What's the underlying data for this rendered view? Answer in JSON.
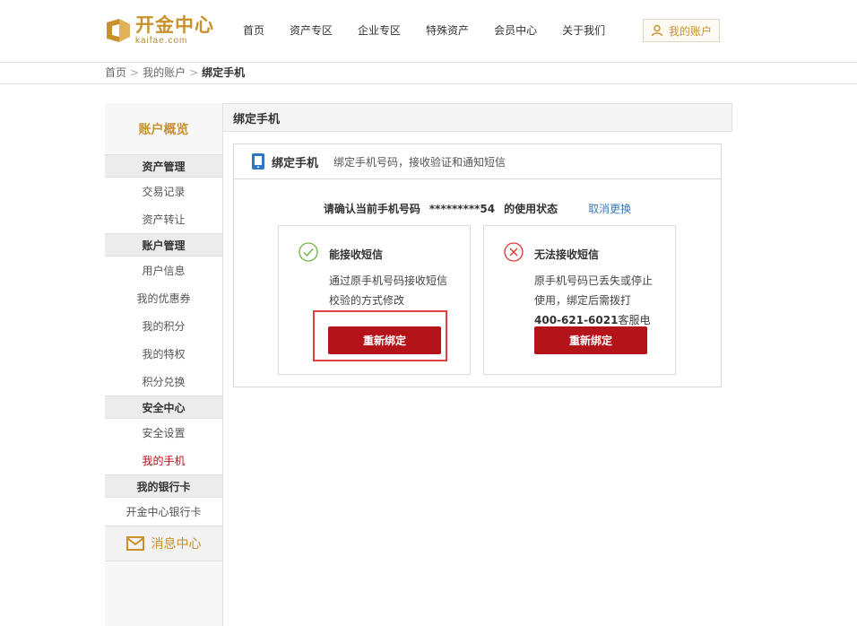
{
  "brand": {
    "name_cn": "开金中心",
    "name_en": "kaifae.com",
    "color": "#c8912c"
  },
  "nav": {
    "items": [
      "首页",
      "资产专区",
      "企业专区",
      "特殊资产",
      "会员中心",
      "关于我们"
    ],
    "account": "我的账户"
  },
  "breadcrumb": {
    "home": "首页",
    "account": "我的账户",
    "current": "绑定手机",
    "sep": ">"
  },
  "sidebar": {
    "overview": "账户概览",
    "groups": [
      {
        "title": "资产管理",
        "items": [
          "交易记录",
          "资产转让"
        ]
      },
      {
        "title": "账户管理",
        "items": [
          "用户信息",
          "我的优惠券",
          "我的积分",
          "我的特权",
          "积分兑换"
        ]
      },
      {
        "title": "安全中心",
        "items": [
          "安全设置",
          "我的手机"
        ]
      },
      {
        "title": "我的银行卡",
        "items": [
          "开金中心银行卡"
        ]
      }
    ],
    "active_item": "我的手机",
    "messages": "消息中心"
  },
  "main": {
    "title": "绑定手机",
    "panel": {
      "title": "绑定手机",
      "desc": "绑定手机号码，接收验证和通知短信",
      "confirm_prefix": "请确认当前手机号码",
      "masked_number": "*********54",
      "confirm_suffix": "的使用状态",
      "cancel_link": "取消更换"
    },
    "cards": [
      {
        "title": "能接收短信",
        "lines": [
          "通过原手机号码接收短信",
          "校验的方式修改"
        ],
        "button": "重新绑定",
        "status": "ok"
      },
      {
        "title": "无法接收短信",
        "lines": [
          "原手机号码已丢失或停止",
          "使用，绑定后需拨打"
        ],
        "hotline": "400-621-6021",
        "hotline_suffix": "客服电",
        "button": "重新绑定",
        "status": "fail"
      }
    ]
  },
  "colors": {
    "accent_red": "#b5131a",
    "link_blue": "#3b7bbf",
    "gold": "#c8912c",
    "ok_green": "#6cb33e",
    "fail_red": "#e0352b"
  }
}
